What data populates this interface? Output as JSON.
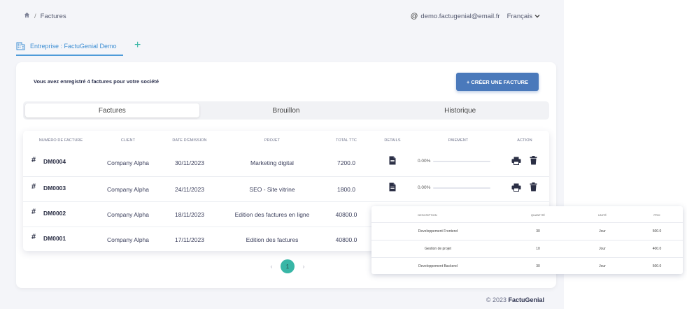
{
  "breadcrumb": {
    "current": "Factures"
  },
  "user": {
    "email": "demo.factugenial@email.fr",
    "language": "Français"
  },
  "tabs": {
    "company": "Entreprise : FactuGenial Demo",
    "add": "+"
  },
  "summary": "Vous avez enregistré 4 factures pour votre société",
  "create_button": "+ CRÉER UNE FACTURE",
  "segments": [
    "Factures",
    "Brouillon",
    "Historique"
  ],
  "table": {
    "headers": [
      "NUMÉRO DE FACTURE",
      "CLIENT",
      "DATE D'ÉMISSION",
      "PROJET",
      "TOTAL TTC",
      "DETAILS",
      "PAIEMENT",
      "ACTION"
    ],
    "rows": [
      {
        "hash": "#",
        "number": "DM0004",
        "client": "Company Alpha",
        "date": "30/11/2023",
        "project": "Marketing digital",
        "total": "7200.0",
        "payment": "0.00%"
      },
      {
        "hash": "#",
        "number": "DM0003",
        "client": "Company Alpha",
        "date": "24/11/2023",
        "project": "SEO - Site vitrine",
        "total": "1800.0",
        "payment": "0.00%"
      },
      {
        "hash": "#",
        "number": "DM0002",
        "client": "Company Alpha",
        "date": "18/11/2023",
        "project": "Edition des factures en ligne",
        "total": "40800.0",
        "payment": ""
      },
      {
        "hash": "#",
        "number": "DM0001",
        "client": "Company Alpha",
        "date": "17/11/2023",
        "project": "Edition des factures",
        "total": "40800.0",
        "payment": ""
      }
    ]
  },
  "pagination": {
    "prev": "‹",
    "page": "1",
    "next": "›"
  },
  "footer": {
    "copyright": "© 2023",
    "brand": "FactuGenial"
  },
  "popup": {
    "headers": [
      "DESCRIPTION",
      "QUANTITÉ",
      "UNITÉ",
      "PRIX"
    ],
    "rows": [
      {
        "description": "Developpement Frontend",
        "quantity": "30",
        "unit": "Jour",
        "price": "500.0"
      },
      {
        "description": "Gestion de projet",
        "quantity": "10",
        "unit": "Jour",
        "price": "400.0"
      },
      {
        "description": "Developpement Backend",
        "quantity": "30",
        "unit": "Jour",
        "price": "500.0"
      }
    ]
  },
  "colors": {
    "accent": "#38b6a6",
    "primary": "#4a79bb",
    "tab": "#3f8fd4"
  },
  "icons": {
    "home": "home-icon",
    "building": "building-icon",
    "document": "document-icon",
    "print": "print-icon",
    "trash": "trash-icon",
    "chevron": "chevron-down-icon"
  }
}
